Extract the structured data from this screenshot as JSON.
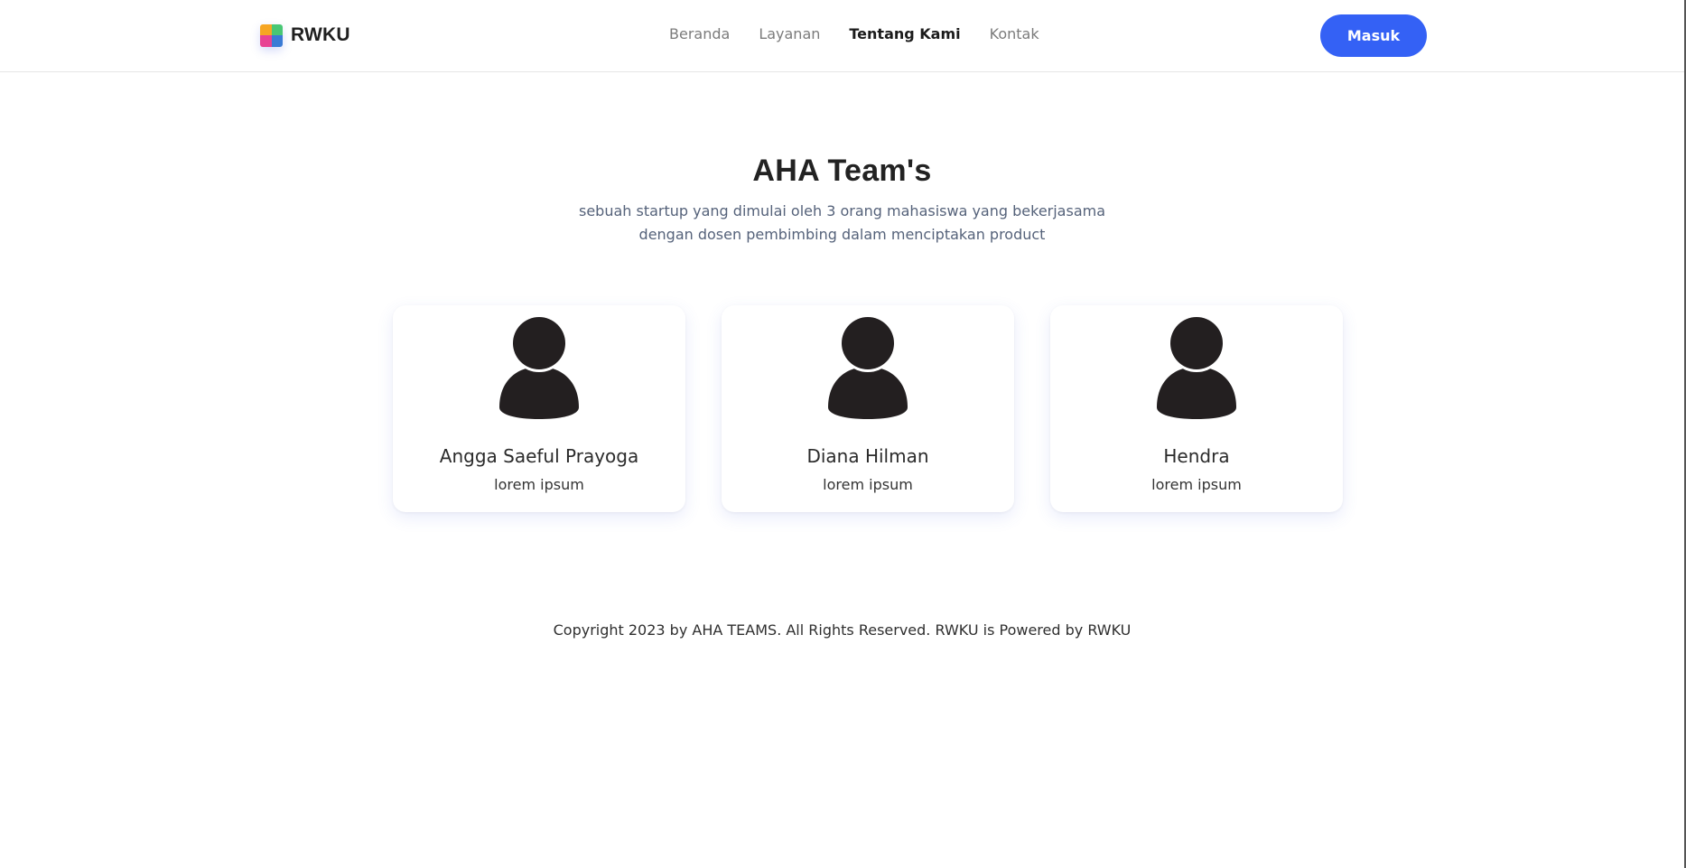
{
  "brand": {
    "name": "RWKU",
    "logo_letters": [
      "R",
      "W",
      "K",
      "U"
    ],
    "logo_colors": [
      "#f6a623",
      "#48c774",
      "#e84393",
      "#3a7bd5"
    ]
  },
  "nav": {
    "items": [
      {
        "label": "Beranda",
        "active": false
      },
      {
        "label": "Layanan",
        "active": false
      },
      {
        "label": "Tentang Kami",
        "active": true
      },
      {
        "label": "Kontak",
        "active": false
      }
    ]
  },
  "header": {
    "login_label": "Masuk"
  },
  "hero": {
    "title": "AHA Team's",
    "subtitle": "sebuah startup yang dimulai oleh 3 orang mahasiswa yang bekerjasama dengan dosen pembimbing dalam menciptakan product"
  },
  "team": [
    {
      "name": "Angga Saeful Prayoga",
      "role": "lorem ipsum",
      "icon": "user-avatar-icon"
    },
    {
      "name": "Diana Hilman",
      "role": "lorem ipsum",
      "icon": "user-avatar-icon"
    },
    {
      "name": "Hendra",
      "role": "lorem ipsum",
      "icon": "user-avatar-icon"
    }
  ],
  "footer": {
    "text": "Copyright 2023 by AHA TEAMS. All Rights Reserved. RWKU is Powered by RWKU"
  },
  "colors": {
    "accent": "#3461f5",
    "text": "#222222",
    "muted": "#7b7b7b"
  }
}
